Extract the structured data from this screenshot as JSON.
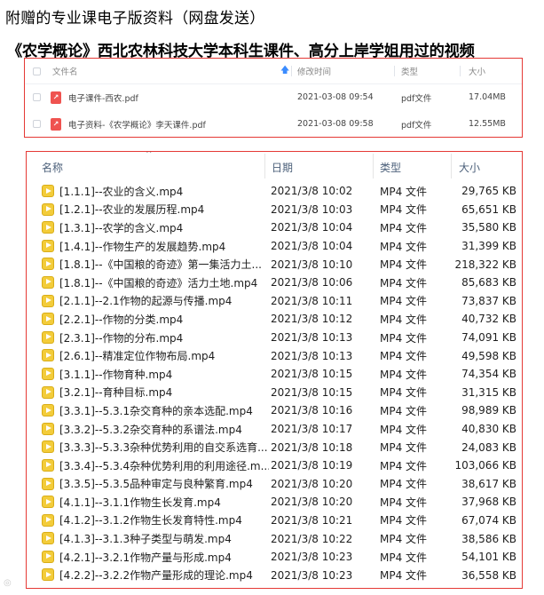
{
  "heading_line1": "附赠的专业课电子版资料（网盘发送）",
  "heading_line2": "《农学概论》西北农林科技大学本科生课件、高分上岸学姐用过的视频",
  "cloud_list": {
    "columns": {
      "name": "文件名",
      "modified": "修改时间",
      "type": "类型",
      "size": "大小"
    },
    "sort_icon": "arrow-up",
    "files": [
      {
        "name": "电子课件-西农.pdf",
        "modified": "2021-03-08 09:54",
        "type": "pdf文件",
        "size": "17.04MB",
        "icon": "pdf-icon",
        "icon_glyph": "↗"
      },
      {
        "name": "电子资料-《农学概论》李天课件.pdf",
        "modified": "2021-03-08 09:58",
        "type": "pdf文件",
        "size": "12.55MB",
        "icon": "pdf-icon",
        "icon_glyph": "↗"
      }
    ]
  },
  "explorer": {
    "columns": {
      "name": "名称",
      "date": "日期",
      "type": "类型",
      "size": "大小"
    },
    "sort_indicator": "^",
    "files": [
      {
        "name": "[1.1.1]--农业的含义.mp4",
        "date": "2021/3/8 10:02",
        "type": "MP4 文件",
        "size": "29,765 KB"
      },
      {
        "name": "[1.2.1]--农业的发展历程.mp4",
        "date": "2021/3/8 10:03",
        "type": "MP4 文件",
        "size": "65,651 KB"
      },
      {
        "name": "[1.3.1]--农学的含义.mp4",
        "date": "2021/3/8 10:04",
        "type": "MP4 文件",
        "size": "35,580 KB"
      },
      {
        "name": "[1.4.1]--作物生产的发展趋势.mp4",
        "date": "2021/3/8 10:04",
        "type": "MP4 文件",
        "size": "31,399 KB"
      },
      {
        "name": "[1.8.1]--《中国粮的奇迹》第一集活力土...",
        "date": "2021/3/8 10:10",
        "type": "MP4 文件",
        "size": "218,322 KB"
      },
      {
        "name": "[1.8.1]--《中国粮的奇迹》活力土地.mp4",
        "date": "2021/3/8 10:06",
        "type": "MP4 文件",
        "size": "85,683 KB"
      },
      {
        "name": "[2.1.1]--2.1作物的起源与传播.mp4",
        "date": "2021/3/8 10:11",
        "type": "MP4 文件",
        "size": "73,837 KB"
      },
      {
        "name": "[2.2.1]--作物的分类.mp4",
        "date": "2021/3/8 10:12",
        "type": "MP4 文件",
        "size": "40,732 KB"
      },
      {
        "name": "[2.3.1]--作物的分布.mp4",
        "date": "2021/3/8 10:13",
        "type": "MP4 文件",
        "size": "74,091 KB"
      },
      {
        "name": "[2.6.1]--精准定位作物布局.mp4",
        "date": "2021/3/8 10:13",
        "type": "MP4 文件",
        "size": "49,598 KB"
      },
      {
        "name": "[3.1.1]--作物育种.mp4",
        "date": "2021/3/8 10:15",
        "type": "MP4 文件",
        "size": "74,354 KB"
      },
      {
        "name": "[3.2.1]--育种目标.mp4",
        "date": "2021/3/8 10:15",
        "type": "MP4 文件",
        "size": "31,315 KB"
      },
      {
        "name": "[3.3.1]--5.3.1杂交育种的亲本选配.mp4",
        "date": "2021/3/8 10:16",
        "type": "MP4 文件",
        "size": "98,989 KB"
      },
      {
        "name": "[3.3.2]--5.3.2杂交育种的系谱法.mp4",
        "date": "2021/3/8 10:17",
        "type": "MP4 文件",
        "size": "40,830 KB"
      },
      {
        "name": "[3.3.3]--5.3.3杂种优势利用的自交系选育...",
        "date": "2021/3/8 10:18",
        "type": "MP4 文件",
        "size": "24,083 KB"
      },
      {
        "name": "[3.3.4]--5.3.4杂种优势利用的利用途径.m...",
        "date": "2021/3/8 10:19",
        "type": "MP4 文件",
        "size": "103,066 KB"
      },
      {
        "name": "[3.3.5]--5.3.5品种审定与良种繁育.mp4",
        "date": "2021/3/8 10:20",
        "type": "MP4 文件",
        "size": "38,617 KB"
      },
      {
        "name": "[4.1.1]--3.1.1作物生长发育.mp4",
        "date": "2021/3/8 10:20",
        "type": "MP4 文件",
        "size": "37,968 KB"
      },
      {
        "name": "[4.1.2]--3.1.2作物生长发育特性.mp4",
        "date": "2021/3/8 10:21",
        "type": "MP4 文件",
        "size": "67,074 KB"
      },
      {
        "name": "[4.1.3]--3.1.3种子类型与萌发.mp4",
        "date": "2021/3/8 10:22",
        "type": "MP4 文件",
        "size": "38,586 KB"
      },
      {
        "name": "[4.2.1]--3.2.1作物产量与形成.mp4",
        "date": "2021/3/8 10:23",
        "type": "MP4 文件",
        "size": "54,101 KB"
      },
      {
        "name": "[4.2.2]--3.2.2作物产量形成的理论.mp4",
        "date": "2021/3/8 10:23",
        "type": "MP4 文件",
        "size": "36,558 KB"
      }
    ]
  },
  "colors": {
    "highlight_border": "#e53935",
    "mp4_icon": "#f3cc3a",
    "pdf_icon": "#ef5350"
  }
}
